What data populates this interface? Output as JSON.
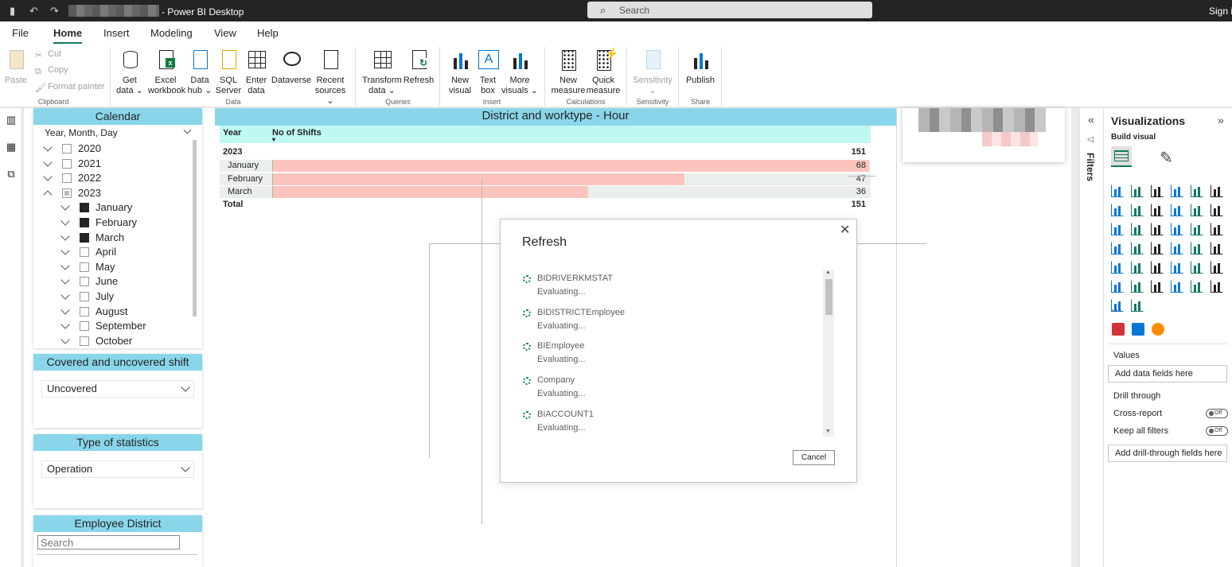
{
  "titlebar": {
    "app_title": "- Power BI Desktop",
    "search_placeholder": "Search",
    "sign_in": "Sign i"
  },
  "menu": {
    "tabs": [
      "File",
      "Home",
      "Insert",
      "Modeling",
      "View",
      "Help"
    ],
    "active": "Home"
  },
  "ribbon": {
    "clipboard": {
      "paste": "Paste",
      "cut": "Cut",
      "copy": "Copy",
      "format_painter": "Format painter",
      "group": "Clipboard"
    },
    "data": {
      "get_data": [
        "Get",
        "data ⌄"
      ],
      "excel": [
        "Excel",
        "workbook"
      ],
      "data_hub": [
        "Data",
        "hub ⌄"
      ],
      "sql": [
        "SQL",
        "Server"
      ],
      "enter_data": [
        "Enter",
        "data"
      ],
      "dataverse": [
        "Dataverse",
        ""
      ],
      "recent": [
        "Recent",
        "sources ⌄"
      ],
      "group": "Data"
    },
    "queries": {
      "transform": [
        "Transform",
        "data ⌄"
      ],
      "refresh": [
        "Refresh",
        ""
      ],
      "group": "Queries"
    },
    "insert": {
      "new_visual": [
        "New",
        "visual"
      ],
      "text_box": [
        "Text",
        "box"
      ],
      "more_visuals": [
        "More",
        "visuals ⌄"
      ],
      "group": "Insert"
    },
    "calculations": {
      "new_measure": [
        "New",
        "measure"
      ],
      "quick_measure": [
        "Quick",
        "measure"
      ],
      "group": "Calculations"
    },
    "sensitivity": {
      "label": [
        "Sensitivity",
        "⌄"
      ],
      "group": "Sensitivity"
    },
    "share": {
      "publish": [
        "Publish",
        ""
      ],
      "group": "Share"
    }
  },
  "calendar_slicer": {
    "title": "Calendar",
    "hierarchy": "Year, Month, Day",
    "years": [
      {
        "label": "2020",
        "state": "off",
        "expanded": false
      },
      {
        "label": "2021",
        "state": "off",
        "expanded": false
      },
      {
        "label": "2022",
        "state": "off",
        "expanded": false
      },
      {
        "label": "2023",
        "state": "partial",
        "expanded": true
      }
    ],
    "months": [
      {
        "label": "January",
        "checked": true
      },
      {
        "label": "February",
        "checked": true
      },
      {
        "label": "March",
        "checked": true
      },
      {
        "label": "April",
        "checked": false
      },
      {
        "label": "May",
        "checked": false
      },
      {
        "label": "June",
        "checked": false
      },
      {
        "label": "July",
        "checked": false
      },
      {
        "label": "August",
        "checked": false
      },
      {
        "label": "September",
        "checked": false
      },
      {
        "label": "October",
        "checked": false
      }
    ]
  },
  "covered_slicer": {
    "title": "Covered and uncovered shift",
    "value": "Uncovered"
  },
  "stats_slicer": {
    "title": "Type of statistics",
    "value": "Operation"
  },
  "district_slicer": {
    "title": "Employee District",
    "search_placeholder": "Search"
  },
  "matrix": {
    "title": "District and worktype - Hour",
    "col_year": "Year",
    "col_shifts": "No of Shifts",
    "year_row": {
      "label": "2023",
      "value": "151"
    },
    "rows": [
      {
        "label": "January",
        "value": 68
      },
      {
        "label": "February",
        "value": 47
      },
      {
        "label": "March",
        "value": 36
      }
    ],
    "bar_max": 68,
    "total": {
      "label": "Total",
      "value": "151"
    }
  },
  "refresh_dialog": {
    "title": "Refresh",
    "items": [
      {
        "name": "BIDRIVERKMSTAT",
        "status": "Evaluating..."
      },
      {
        "name": "BIDISTRICTEmployee",
        "status": "Evaluating..."
      },
      {
        "name": "BIEmployee",
        "status": "Evaluating..."
      },
      {
        "name": "Company",
        "status": "Evaluating..."
      },
      {
        "name": "BIACCOUNT1",
        "status": "Evaluating..."
      }
    ],
    "cancel": "Cancel"
  },
  "filters_pane": {
    "label": "Filters"
  },
  "viz_pane": {
    "title": "Visualizations",
    "build_visual": "Build visual",
    "values_label": "Values",
    "values_well": "Add data fields here",
    "drill_through": "Drill through",
    "cross_report": "Cross-report",
    "keep_all_filters": "Keep all filters",
    "toggle_off": "Off",
    "drill_well": "Add drill-through fields here",
    "more": "···",
    "visual_icons": [
      "stacked-bar-icon",
      "stacked-column-icon",
      "clustered-bar-icon",
      "clustered-column-icon",
      "100-bar-icon",
      "100-column-icon",
      "line-chart-icon",
      "area-chart-icon",
      "stacked-area-icon",
      "line-column-icon",
      "line-clustered-icon",
      "ribbon-chart-icon",
      "waterfall-icon",
      "funnel-icon",
      "scatter-icon",
      "pie-icon",
      "donut-icon",
      "treemap-icon",
      "map-icon",
      "filled-map-icon",
      "gauge-icon",
      "card-icon",
      "multi-row-card-icon",
      "kpi-icon",
      "slicer-icon",
      "table-icon",
      "matrix-icon",
      "r-visual-icon",
      "python-visual-icon",
      "key-influencers-icon",
      "decomposition-tree-icon",
      "qa-icon",
      "paginated-icon",
      "trophy-icon",
      "narrative-icon",
      "power-apps-icon",
      "power-automate-icon",
      "get-more-icon"
    ],
    "custom_icons": [
      "calendar-visual-icon",
      "list-visual-icon",
      "fish-visual-icon"
    ]
  },
  "colors": {
    "header_cyan": "#89d6ea",
    "column_header": "#bff7f2",
    "bar_fill": "#fcc4bd",
    "accent": "#117865"
  }
}
